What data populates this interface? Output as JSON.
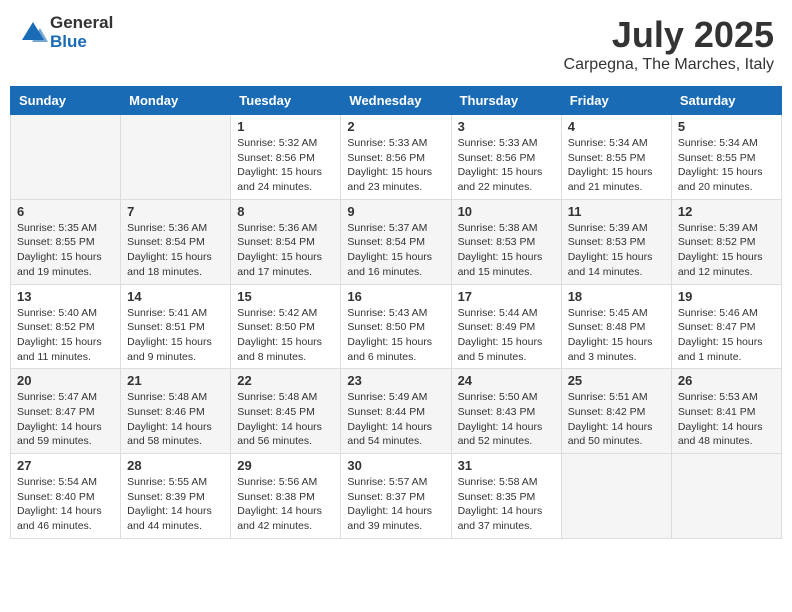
{
  "header": {
    "logo_general": "General",
    "logo_blue": "Blue",
    "month": "July 2025",
    "location": "Carpegna, The Marches, Italy"
  },
  "days_of_week": [
    "Sunday",
    "Monday",
    "Tuesday",
    "Wednesday",
    "Thursday",
    "Friday",
    "Saturday"
  ],
  "weeks": [
    [
      {
        "day": "",
        "sunrise": "",
        "sunset": "",
        "daylight": ""
      },
      {
        "day": "",
        "sunrise": "",
        "sunset": "",
        "daylight": ""
      },
      {
        "day": "1",
        "sunrise": "Sunrise: 5:32 AM",
        "sunset": "Sunset: 8:56 PM",
        "daylight": "Daylight: 15 hours and 24 minutes."
      },
      {
        "day": "2",
        "sunrise": "Sunrise: 5:33 AM",
        "sunset": "Sunset: 8:56 PM",
        "daylight": "Daylight: 15 hours and 23 minutes."
      },
      {
        "day": "3",
        "sunrise": "Sunrise: 5:33 AM",
        "sunset": "Sunset: 8:56 PM",
        "daylight": "Daylight: 15 hours and 22 minutes."
      },
      {
        "day": "4",
        "sunrise": "Sunrise: 5:34 AM",
        "sunset": "Sunset: 8:55 PM",
        "daylight": "Daylight: 15 hours and 21 minutes."
      },
      {
        "day": "5",
        "sunrise": "Sunrise: 5:34 AM",
        "sunset": "Sunset: 8:55 PM",
        "daylight": "Daylight: 15 hours and 20 minutes."
      }
    ],
    [
      {
        "day": "6",
        "sunrise": "Sunrise: 5:35 AM",
        "sunset": "Sunset: 8:55 PM",
        "daylight": "Daylight: 15 hours and 19 minutes."
      },
      {
        "day": "7",
        "sunrise": "Sunrise: 5:36 AM",
        "sunset": "Sunset: 8:54 PM",
        "daylight": "Daylight: 15 hours and 18 minutes."
      },
      {
        "day": "8",
        "sunrise": "Sunrise: 5:36 AM",
        "sunset": "Sunset: 8:54 PM",
        "daylight": "Daylight: 15 hours and 17 minutes."
      },
      {
        "day": "9",
        "sunrise": "Sunrise: 5:37 AM",
        "sunset": "Sunset: 8:54 PM",
        "daylight": "Daylight: 15 hours and 16 minutes."
      },
      {
        "day": "10",
        "sunrise": "Sunrise: 5:38 AM",
        "sunset": "Sunset: 8:53 PM",
        "daylight": "Daylight: 15 hours and 15 minutes."
      },
      {
        "day": "11",
        "sunrise": "Sunrise: 5:39 AM",
        "sunset": "Sunset: 8:53 PM",
        "daylight": "Daylight: 15 hours and 14 minutes."
      },
      {
        "day": "12",
        "sunrise": "Sunrise: 5:39 AM",
        "sunset": "Sunset: 8:52 PM",
        "daylight": "Daylight: 15 hours and 12 minutes."
      }
    ],
    [
      {
        "day": "13",
        "sunrise": "Sunrise: 5:40 AM",
        "sunset": "Sunset: 8:52 PM",
        "daylight": "Daylight: 15 hours and 11 minutes."
      },
      {
        "day": "14",
        "sunrise": "Sunrise: 5:41 AM",
        "sunset": "Sunset: 8:51 PM",
        "daylight": "Daylight: 15 hours and 9 minutes."
      },
      {
        "day": "15",
        "sunrise": "Sunrise: 5:42 AM",
        "sunset": "Sunset: 8:50 PM",
        "daylight": "Daylight: 15 hours and 8 minutes."
      },
      {
        "day": "16",
        "sunrise": "Sunrise: 5:43 AM",
        "sunset": "Sunset: 8:50 PM",
        "daylight": "Daylight: 15 hours and 6 minutes."
      },
      {
        "day": "17",
        "sunrise": "Sunrise: 5:44 AM",
        "sunset": "Sunset: 8:49 PM",
        "daylight": "Daylight: 15 hours and 5 minutes."
      },
      {
        "day": "18",
        "sunrise": "Sunrise: 5:45 AM",
        "sunset": "Sunset: 8:48 PM",
        "daylight": "Daylight: 15 hours and 3 minutes."
      },
      {
        "day": "19",
        "sunrise": "Sunrise: 5:46 AM",
        "sunset": "Sunset: 8:47 PM",
        "daylight": "Daylight: 15 hours and 1 minute."
      }
    ],
    [
      {
        "day": "20",
        "sunrise": "Sunrise: 5:47 AM",
        "sunset": "Sunset: 8:47 PM",
        "daylight": "Daylight: 14 hours and 59 minutes."
      },
      {
        "day": "21",
        "sunrise": "Sunrise: 5:48 AM",
        "sunset": "Sunset: 8:46 PM",
        "daylight": "Daylight: 14 hours and 58 minutes."
      },
      {
        "day": "22",
        "sunrise": "Sunrise: 5:48 AM",
        "sunset": "Sunset: 8:45 PM",
        "daylight": "Daylight: 14 hours and 56 minutes."
      },
      {
        "day": "23",
        "sunrise": "Sunrise: 5:49 AM",
        "sunset": "Sunset: 8:44 PM",
        "daylight": "Daylight: 14 hours and 54 minutes."
      },
      {
        "day": "24",
        "sunrise": "Sunrise: 5:50 AM",
        "sunset": "Sunset: 8:43 PM",
        "daylight": "Daylight: 14 hours and 52 minutes."
      },
      {
        "day": "25",
        "sunrise": "Sunrise: 5:51 AM",
        "sunset": "Sunset: 8:42 PM",
        "daylight": "Daylight: 14 hours and 50 minutes."
      },
      {
        "day": "26",
        "sunrise": "Sunrise: 5:53 AM",
        "sunset": "Sunset: 8:41 PM",
        "daylight": "Daylight: 14 hours and 48 minutes."
      }
    ],
    [
      {
        "day": "27",
        "sunrise": "Sunrise: 5:54 AM",
        "sunset": "Sunset: 8:40 PM",
        "daylight": "Daylight: 14 hours and 46 minutes."
      },
      {
        "day": "28",
        "sunrise": "Sunrise: 5:55 AM",
        "sunset": "Sunset: 8:39 PM",
        "daylight": "Daylight: 14 hours and 44 minutes."
      },
      {
        "day": "29",
        "sunrise": "Sunrise: 5:56 AM",
        "sunset": "Sunset: 8:38 PM",
        "daylight": "Daylight: 14 hours and 42 minutes."
      },
      {
        "day": "30",
        "sunrise": "Sunrise: 5:57 AM",
        "sunset": "Sunset: 8:37 PM",
        "daylight": "Daylight: 14 hours and 39 minutes."
      },
      {
        "day": "31",
        "sunrise": "Sunrise: 5:58 AM",
        "sunset": "Sunset: 8:35 PM",
        "daylight": "Daylight: 14 hours and 37 minutes."
      },
      {
        "day": "",
        "sunrise": "",
        "sunset": "",
        "daylight": ""
      },
      {
        "day": "",
        "sunrise": "",
        "sunset": "",
        "daylight": ""
      }
    ]
  ]
}
